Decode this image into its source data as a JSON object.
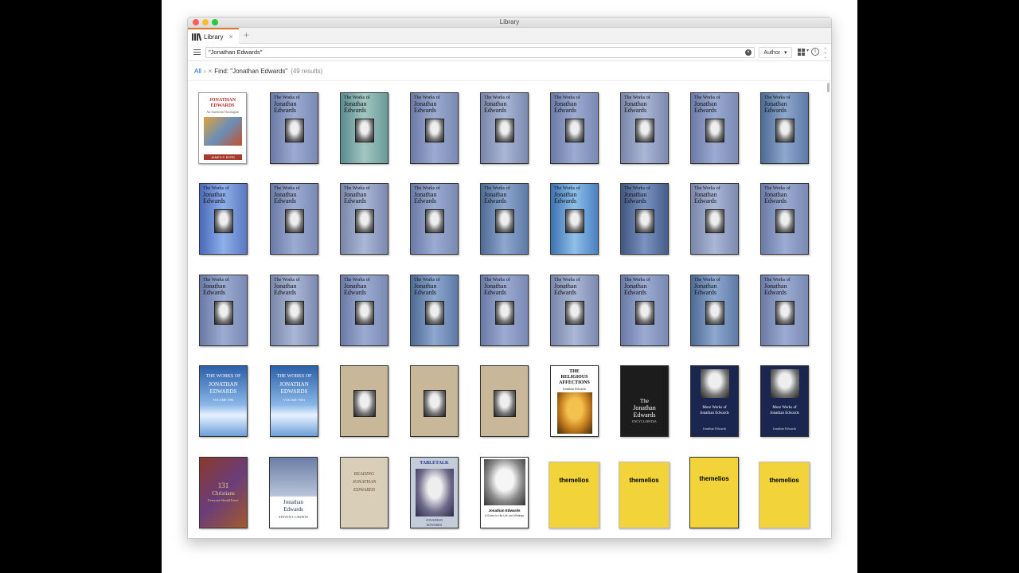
{
  "window": {
    "title": "Library"
  },
  "tabs": [
    {
      "label": "Library",
      "close": "×"
    }
  ],
  "tab_add": "+",
  "search": {
    "value": "\"Jonathan Edwards\"",
    "clear": "×"
  },
  "sort": {
    "label": "Author",
    "caret": "▾"
  },
  "breadcrumb": {
    "all": "All",
    "sep": "›",
    "remove": "×",
    "find": "Find: \"Jonathan Edwards\"",
    "count": "(49 results)"
  },
  "covers": {
    "first": {
      "line1": "JONATHAN",
      "line2": "EDWARDS",
      "line3": "An American Theologian",
      "author": "JAMES P. BYRD"
    },
    "yale": {
      "line1": "The Works of",
      "line2": "Jonathan",
      "line3": "Edwards"
    },
    "blue": {
      "line1": "THE WORKS OF",
      "line2": "JONATHAN",
      "line3": "EDWARDS",
      "vol1": "VOLUME ONE",
      "vol2": "VOLUME TWO"
    },
    "ra": {
      "line1": "THE",
      "line2": "RELIGIOUS",
      "line3": "AFFECTIONS",
      "author": "Jonathan Edwards"
    },
    "enc": {
      "line1": "The",
      "line2": "Jonathan",
      "line3": "Edwards",
      "line4": "ENCYCLOPEDIA"
    },
    "more": {
      "line1": "More Works of",
      "line2": "Jonathan Edwards",
      "author": "Jonathan Edwards"
    },
    "christians": {
      "line1": "131",
      "line2": "Christians",
      "line3": "Everyone Should Know"
    },
    "revival": {
      "line1": "Jonathan",
      "line2": "Edwards",
      "author": "STEVEN J. LAWSON"
    },
    "reading": {
      "line1": "READING",
      "line2": "JONATHAN",
      "line3": "EDWARDS"
    },
    "tabletalk": {
      "line1": "TABLETALK",
      "line2": "JONATHAN",
      "line3": "EDWARDS"
    },
    "guide": {
      "line1": "Jonathan Edwards",
      "line2": "A Guide to His Life and Writings"
    },
    "themelios": {
      "line1": "themelios"
    }
  }
}
